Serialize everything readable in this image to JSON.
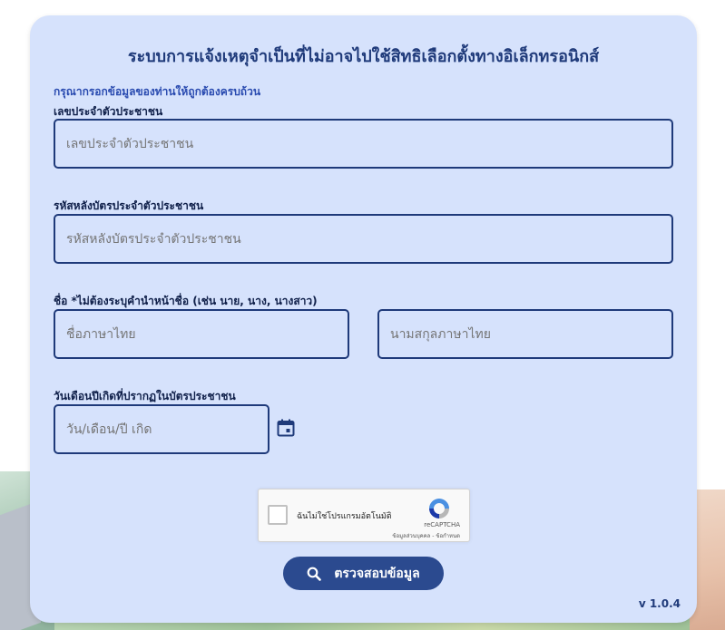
{
  "form": {
    "title": "ระบบการแจ้งเหตุจำเป็นที่ไม่อาจไปใช้สิทธิเลือกตั้งทางอิเล็กทรอนิกส์",
    "hint": "กรุณากรอกข้อมูลของท่านให้ถูกต้องครบถ้วน",
    "citizen_id": {
      "label": "เลขประจำตัวประชาชน",
      "placeholder": "เลขประจำตัวประชาชน",
      "value": ""
    },
    "laser_code": {
      "label": "รหัสหลังบัตรประจำตัวประชาชน",
      "placeholder": "รหัสหลังบัตรประจำตัวประชาชน",
      "value": ""
    },
    "name": {
      "label": "ชื่อ *ไม่ต้องระบุคำนำหน้าชื่อ (เช่น นาย, นาง, นางสาว)",
      "first_placeholder": "ชื่อภาษาไทย",
      "last_placeholder": "นามสกุลภาษาไทย"
    },
    "birth_date": {
      "label": "วันเดือนปีเกิดที่ปรากฏในบัตรประชาชน",
      "placeholder": "วัน/เดือน/ปี เกิด",
      "icon": "calendar-icon"
    },
    "captcha": {
      "label": "ฉันไม่ใช่โปรแกรมอัตโนมัติ",
      "brand": "reCAPTCHA",
      "links": "ข้อมูลส่วนบุคคล - ข้อกำหนด",
      "checked": false
    },
    "submit": {
      "label": "ตรวจสอบข้อมูล",
      "icon": "search-icon"
    },
    "version": "v 1.0.4"
  },
  "colors": {
    "card_bg": "#d6e2fc",
    "primary": "#1f3a7a",
    "button": "#2b4a8f",
    "hint": "#2a4bb0"
  }
}
